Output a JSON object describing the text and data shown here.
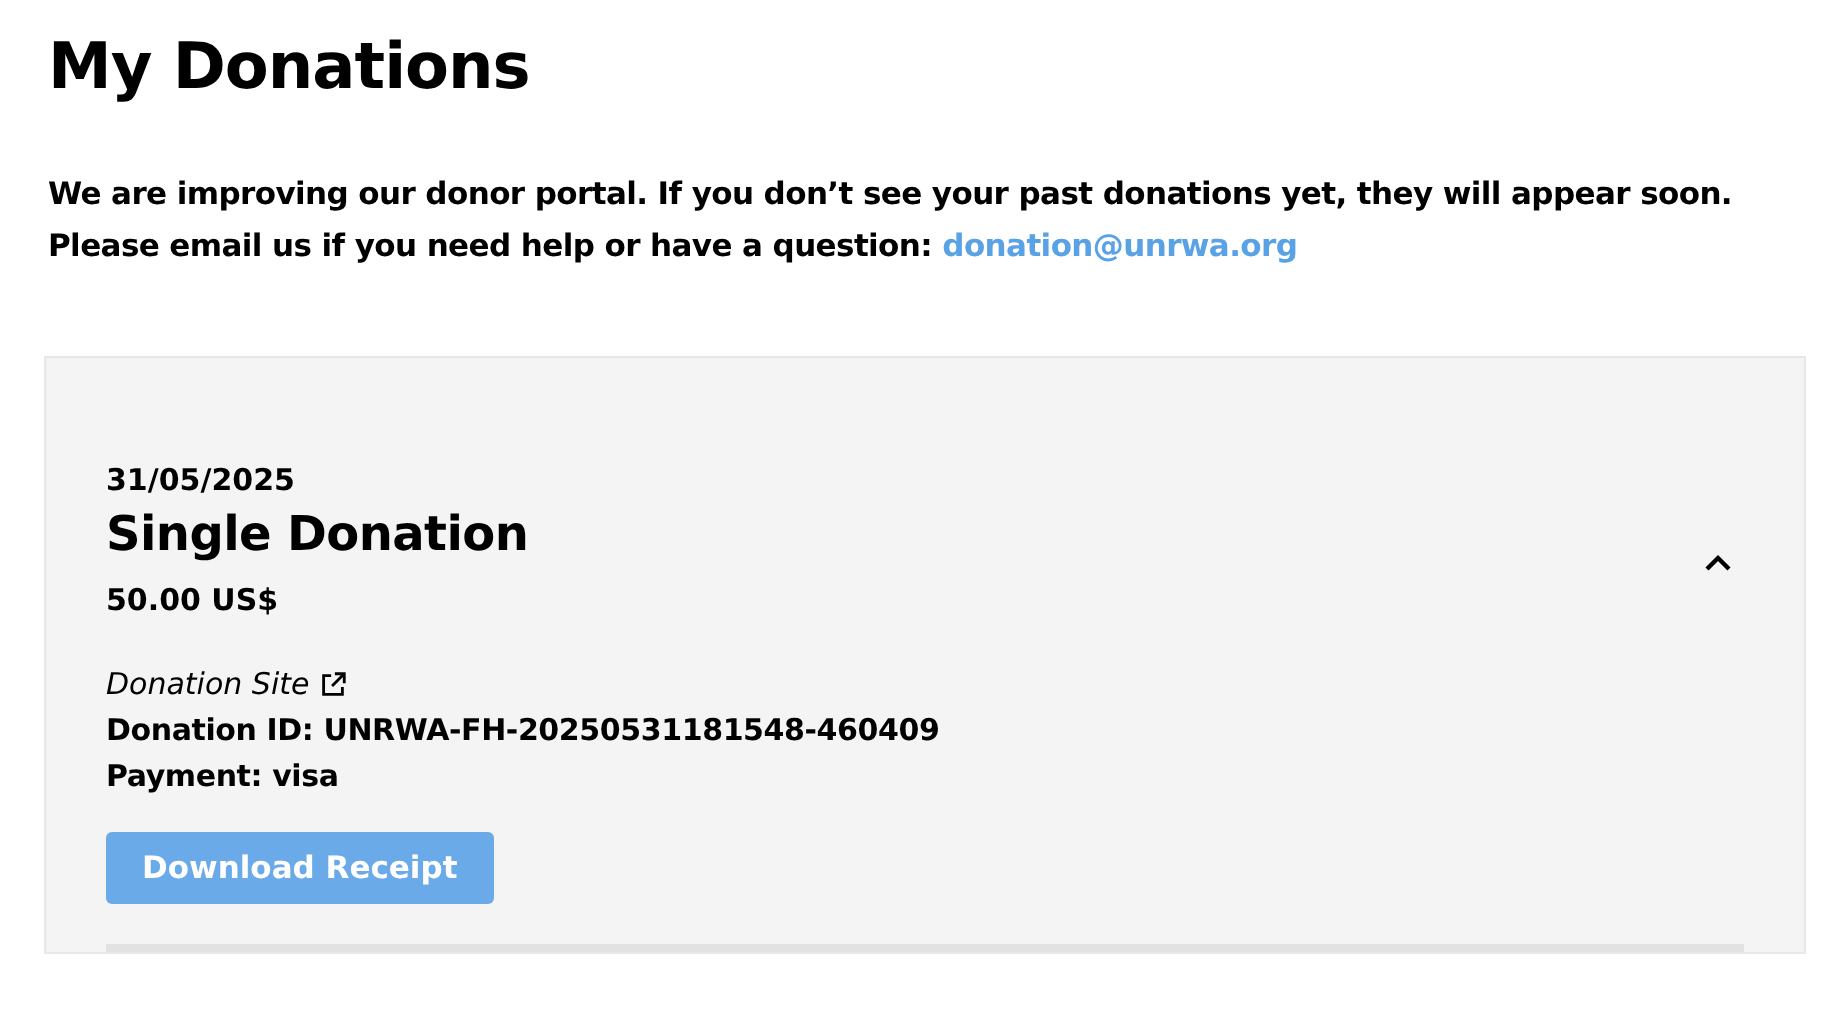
{
  "page_title": "My Donations",
  "notice": {
    "text": "We are improving our donor portal. If you don’t see your past donations yet, they will appear soon. Please email us if you need help or have a question:",
    "email": "donation@unrwa.org"
  },
  "donations": [
    {
      "date": "31/05/2025",
      "title": "Single Donation",
      "amount": "50.00 US$",
      "expanded": true,
      "source": "Donation Site",
      "donation_id": "Donation ID: UNRWA-FH-20250531181548-460409",
      "payment": "Payment: visa",
      "receipt_button": "Download Receipt"
    }
  ]
}
